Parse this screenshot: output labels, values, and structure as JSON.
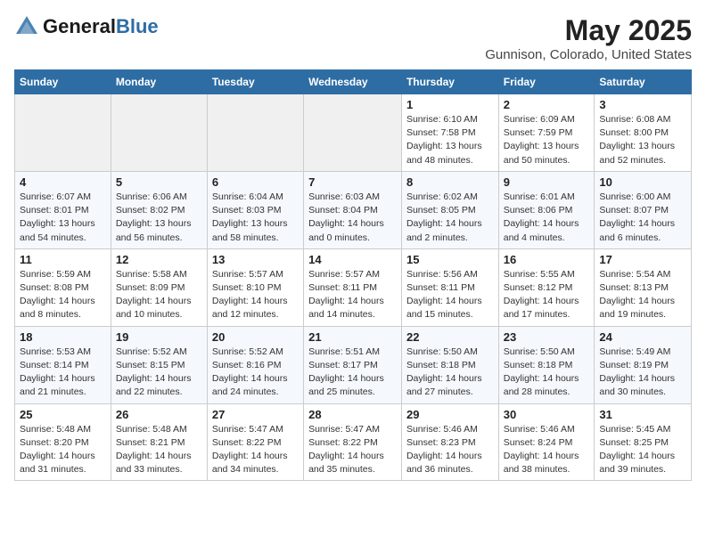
{
  "header": {
    "logo_general": "General",
    "logo_blue": "Blue",
    "month": "May 2025",
    "location": "Gunnison, Colorado, United States"
  },
  "weekdays": [
    "Sunday",
    "Monday",
    "Tuesday",
    "Wednesday",
    "Thursday",
    "Friday",
    "Saturday"
  ],
  "weeks": [
    [
      {
        "day": "",
        "info": ""
      },
      {
        "day": "",
        "info": ""
      },
      {
        "day": "",
        "info": ""
      },
      {
        "day": "",
        "info": ""
      },
      {
        "day": "1",
        "info": "Sunrise: 6:10 AM\nSunset: 7:58 PM\nDaylight: 13 hours\nand 48 minutes."
      },
      {
        "day": "2",
        "info": "Sunrise: 6:09 AM\nSunset: 7:59 PM\nDaylight: 13 hours\nand 50 minutes."
      },
      {
        "day": "3",
        "info": "Sunrise: 6:08 AM\nSunset: 8:00 PM\nDaylight: 13 hours\nand 52 minutes."
      }
    ],
    [
      {
        "day": "4",
        "info": "Sunrise: 6:07 AM\nSunset: 8:01 PM\nDaylight: 13 hours\nand 54 minutes."
      },
      {
        "day": "5",
        "info": "Sunrise: 6:06 AM\nSunset: 8:02 PM\nDaylight: 13 hours\nand 56 minutes."
      },
      {
        "day": "6",
        "info": "Sunrise: 6:04 AM\nSunset: 8:03 PM\nDaylight: 13 hours\nand 58 minutes."
      },
      {
        "day": "7",
        "info": "Sunrise: 6:03 AM\nSunset: 8:04 PM\nDaylight: 14 hours\nand 0 minutes."
      },
      {
        "day": "8",
        "info": "Sunrise: 6:02 AM\nSunset: 8:05 PM\nDaylight: 14 hours\nand 2 minutes."
      },
      {
        "day": "9",
        "info": "Sunrise: 6:01 AM\nSunset: 8:06 PM\nDaylight: 14 hours\nand 4 minutes."
      },
      {
        "day": "10",
        "info": "Sunrise: 6:00 AM\nSunset: 8:07 PM\nDaylight: 14 hours\nand 6 minutes."
      }
    ],
    [
      {
        "day": "11",
        "info": "Sunrise: 5:59 AM\nSunset: 8:08 PM\nDaylight: 14 hours\nand 8 minutes."
      },
      {
        "day": "12",
        "info": "Sunrise: 5:58 AM\nSunset: 8:09 PM\nDaylight: 14 hours\nand 10 minutes."
      },
      {
        "day": "13",
        "info": "Sunrise: 5:57 AM\nSunset: 8:10 PM\nDaylight: 14 hours\nand 12 minutes."
      },
      {
        "day": "14",
        "info": "Sunrise: 5:57 AM\nSunset: 8:11 PM\nDaylight: 14 hours\nand 14 minutes."
      },
      {
        "day": "15",
        "info": "Sunrise: 5:56 AM\nSunset: 8:11 PM\nDaylight: 14 hours\nand 15 minutes."
      },
      {
        "day": "16",
        "info": "Sunrise: 5:55 AM\nSunset: 8:12 PM\nDaylight: 14 hours\nand 17 minutes."
      },
      {
        "day": "17",
        "info": "Sunrise: 5:54 AM\nSunset: 8:13 PM\nDaylight: 14 hours\nand 19 minutes."
      }
    ],
    [
      {
        "day": "18",
        "info": "Sunrise: 5:53 AM\nSunset: 8:14 PM\nDaylight: 14 hours\nand 21 minutes."
      },
      {
        "day": "19",
        "info": "Sunrise: 5:52 AM\nSunset: 8:15 PM\nDaylight: 14 hours\nand 22 minutes."
      },
      {
        "day": "20",
        "info": "Sunrise: 5:52 AM\nSunset: 8:16 PM\nDaylight: 14 hours\nand 24 minutes."
      },
      {
        "day": "21",
        "info": "Sunrise: 5:51 AM\nSunset: 8:17 PM\nDaylight: 14 hours\nand 25 minutes."
      },
      {
        "day": "22",
        "info": "Sunrise: 5:50 AM\nSunset: 8:18 PM\nDaylight: 14 hours\nand 27 minutes."
      },
      {
        "day": "23",
        "info": "Sunrise: 5:50 AM\nSunset: 8:18 PM\nDaylight: 14 hours\nand 28 minutes."
      },
      {
        "day": "24",
        "info": "Sunrise: 5:49 AM\nSunset: 8:19 PM\nDaylight: 14 hours\nand 30 minutes."
      }
    ],
    [
      {
        "day": "25",
        "info": "Sunrise: 5:48 AM\nSunset: 8:20 PM\nDaylight: 14 hours\nand 31 minutes."
      },
      {
        "day": "26",
        "info": "Sunrise: 5:48 AM\nSunset: 8:21 PM\nDaylight: 14 hours\nand 33 minutes."
      },
      {
        "day": "27",
        "info": "Sunrise: 5:47 AM\nSunset: 8:22 PM\nDaylight: 14 hours\nand 34 minutes."
      },
      {
        "day": "28",
        "info": "Sunrise: 5:47 AM\nSunset: 8:22 PM\nDaylight: 14 hours\nand 35 minutes."
      },
      {
        "day": "29",
        "info": "Sunrise: 5:46 AM\nSunset: 8:23 PM\nDaylight: 14 hours\nand 36 minutes."
      },
      {
        "day": "30",
        "info": "Sunrise: 5:46 AM\nSunset: 8:24 PM\nDaylight: 14 hours\nand 38 minutes."
      },
      {
        "day": "31",
        "info": "Sunrise: 5:45 AM\nSunset: 8:25 PM\nDaylight: 14 hours\nand 39 minutes."
      }
    ]
  ]
}
